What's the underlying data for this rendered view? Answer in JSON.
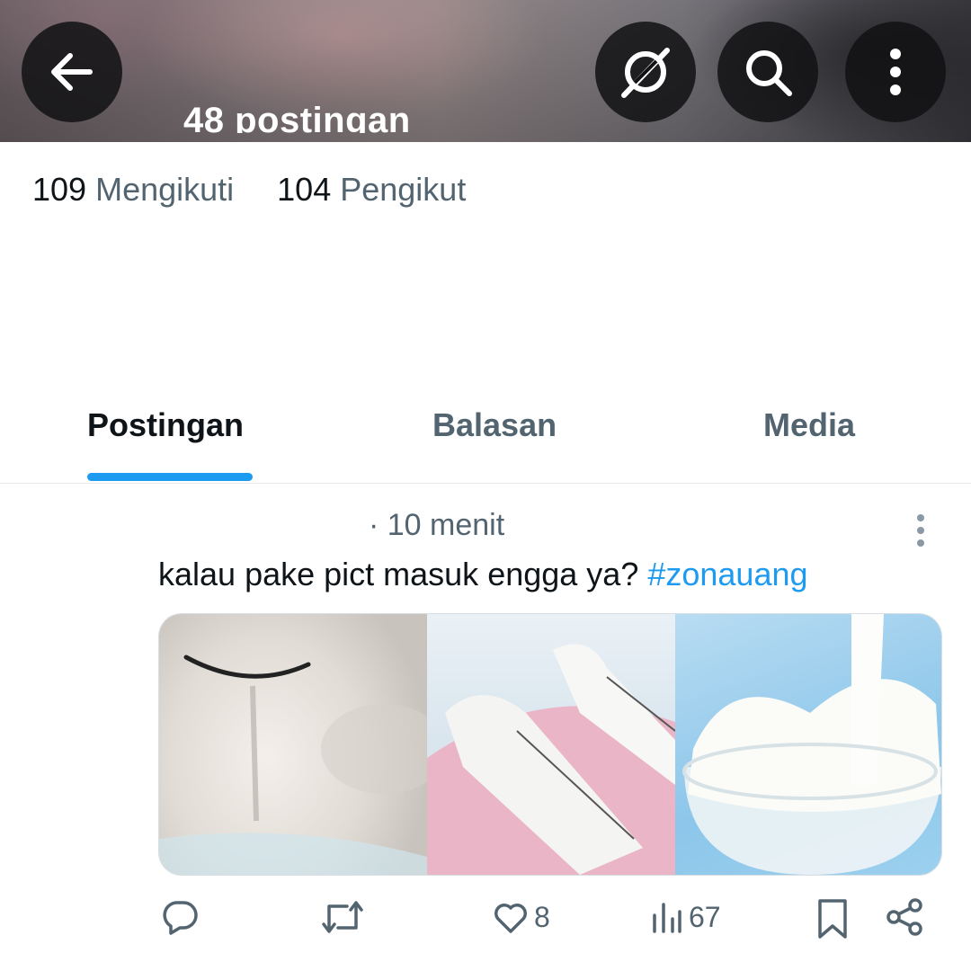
{
  "header": {
    "post_count_label": "48 postingan"
  },
  "stats": [
    {
      "value": "109",
      "label": "Mengikuti"
    },
    {
      "value": "104",
      "label": "Pengikut"
    }
  ],
  "tabs": [
    {
      "label": "Postingan",
      "active": true
    },
    {
      "label": "Balasan",
      "active": false
    },
    {
      "label": "Media",
      "active": false
    }
  ],
  "post": {
    "time": "· 10 menit",
    "text": "kalau pake pict masuk engga ya?",
    "hashtag": "#zonauang",
    "likes": "8",
    "views": "67"
  },
  "colors": {
    "accent": "#1d9bf0",
    "secondary_text": "#536471",
    "primary_text": "#0f1419"
  },
  "icons": [
    "back-arrow-icon",
    "grok-icon",
    "search-icon",
    "more-vertical-icon",
    "reply-icon",
    "retweet-icon",
    "like-icon",
    "views-icon",
    "bookmark-icon",
    "share-icon"
  ]
}
